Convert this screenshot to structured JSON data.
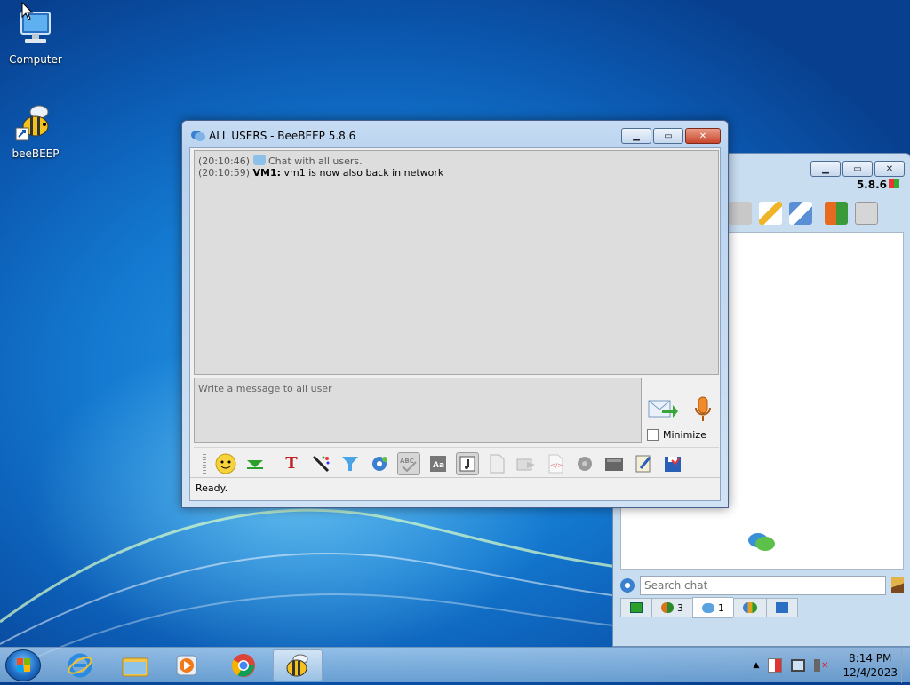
{
  "desktop": {
    "icons": [
      {
        "label": "Computer",
        "icon": "computer-icon"
      },
      {
        "label": "beeBEEP",
        "icon": "bee-icon"
      }
    ]
  },
  "chat_window": {
    "title": "ALL USERS - BeeBEEP 5.8.6",
    "messages": [
      {
        "time": "(20:10:46)",
        "sender": "",
        "text": "Chat with all users."
      },
      {
        "time": "(20:10:59)",
        "sender": "VM1:",
        "text": "vm1 is now also back in network"
      }
    ],
    "compose_placeholder": "Write a message to all user",
    "minimize_label": "Minimize",
    "status": "Ready."
  },
  "main_window": {
    "version": "5.8.6",
    "search_placeholder": "Search chat",
    "tabs": [
      {
        "icon": "user-green-icon",
        "count": ""
      },
      {
        "icon": "group-icon",
        "count": "3"
      },
      {
        "icon": "chat-icon",
        "count": "1"
      },
      {
        "icon": "users-icon",
        "count": ""
      },
      {
        "icon": "flag-icon",
        "count": ""
      }
    ]
  },
  "taskbar": {
    "time": "8:14 PM",
    "date": "12/4/2023"
  }
}
